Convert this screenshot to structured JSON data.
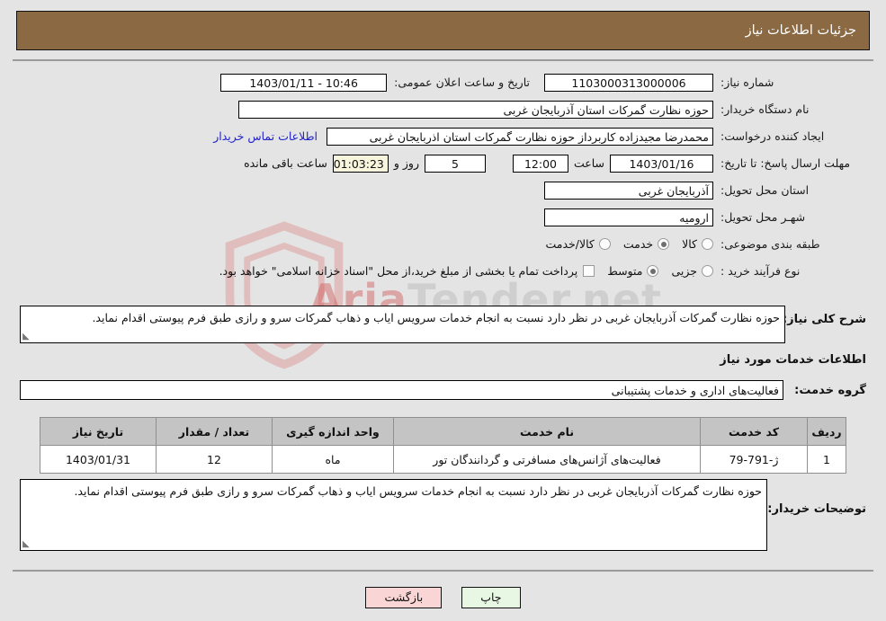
{
  "header": {
    "title": "جزئیات اطلاعات نیاز"
  },
  "form": {
    "need_number_label": "شماره نیاز:",
    "need_number_value": "1103000313000006",
    "public_announce_label": "تاریخ و ساعت اعلان عمومی:",
    "public_announce_value": "10:46 - 1403/01/11",
    "buyer_org_label": "نام دستگاه خریدار:",
    "buyer_org_value": "حوزه نظارت گمرکات استان آذربایجان غربی",
    "creator_label": "ایجاد کننده درخواست:",
    "creator_value": "محمدرضا مجیدزاده کاربرداز حوزه نظارت گمرکات استان اذربایجان غربی",
    "contact_link": "اطلاعات تماس خریدار",
    "deadline_label": "مهلت ارسال پاسخ: تا تاریخ:",
    "deadline_date": "1403/01/16",
    "deadline_hour_label": "ساعت",
    "deadline_hour": "12:00",
    "days_remaining": "5",
    "days_unit": "روز و",
    "countdown": "01:03:23",
    "countdown_suffix": "ساعت باقی مانده",
    "province_label": "استان محل تحویل:",
    "province_value": "آذربایجان غربی",
    "city_label": "شهـر محل تحویل:",
    "city_value": "ارومیه",
    "category_label": "طبقه بندی موضوعی:",
    "category_options": [
      "کالا",
      "خدمت",
      "کالا/خدمت"
    ],
    "category_selected": "خدمت",
    "process_label": "نوع فرآیند خرید :",
    "process_options": [
      "جزیی",
      "متوسط"
    ],
    "process_selected": "متوسط",
    "treasury_note": "پرداخت تمام یا بخشی از مبلغ خرید،از محل \"اسناد خزانه اسلامی\" خواهد بود."
  },
  "description": {
    "label": "شرح کلی نیاز:",
    "value": "حوزه نظارت گمرکات آذربایجان غربی در نظر دارد نسبت به انجام خدمات سرویس ایاب و ذهاب گمرکات سرو و رازی طبق فرم پیوستی اقدام نماید."
  },
  "services": {
    "section_title": "اطلاعات خدمات مورد نیاز",
    "group_label": "گروه خدمت:",
    "group_value": "فعالیت‌های اداری و خدمات پشتیبانی",
    "columns": [
      "ردیف",
      "کد خدمت",
      "نام خدمت",
      "واحد اندازه گیری",
      "تعداد / مقدار",
      "تاریخ نیاز"
    ],
    "rows": [
      {
        "index": "1",
        "code": "ژ-791-79",
        "name": "فعالیت‌های آژانس‌های مسافرتی و گردانندگان تور",
        "unit": "ماه",
        "quantity": "12",
        "need_date": "1403/01/31"
      }
    ]
  },
  "buyer_notes": {
    "label": "توضیحات خریدار:",
    "value": "حوزه نظارت گمرکات آذربایجان غربی در نظر دارد نسبت به انجام خدمات سرویس ایاب و ذهاب گمرکات سرو و رازی طبق فرم پیوستی اقدام نماید."
  },
  "buttons": {
    "back": "بازگشت",
    "print": "چاپ"
  },
  "watermark": {
    "text_left": "Aria",
    "text_right": "Tender.net"
  },
  "colors": {
    "header_bg": "#8b6a43",
    "page_bg": "#e4e4e4",
    "link": "#2222cc",
    "back_btn": "#fad5d5",
    "print_btn": "#e8f6e4",
    "countdown_bg": "#f7f5dc"
  }
}
